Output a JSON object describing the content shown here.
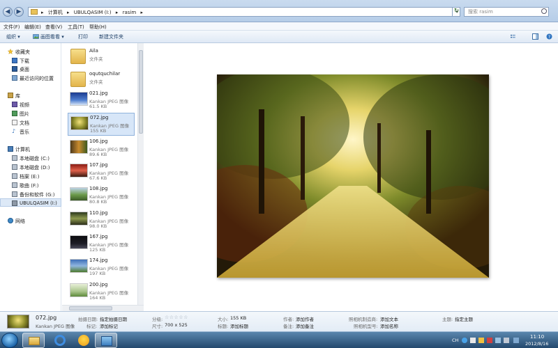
{
  "address": {
    "crumbs": [
      "计算机",
      "UBULQASIM (I:)",
      "rasim"
    ],
    "search_placeholder": "搜索 rasim"
  },
  "menu": {
    "items": [
      "文件(F)",
      "编辑(E)",
      "查看(V)",
      "工具(T)",
      "帮助(H)"
    ]
  },
  "toolbar": {
    "organize": "组织 ▾",
    "preview": "画图看看 ▾",
    "print": "打印",
    "new_folder": "新建文件夹"
  },
  "nav": {
    "favorites": "收藏夹",
    "download": "下载",
    "desktop": "桌面",
    "recent": "最近访问的位置",
    "libraries": "库",
    "videos": "视频",
    "pictures": "图片",
    "documents": "文档",
    "music": "音乐",
    "computer": "计算机",
    "drive_c": "本地磁盘 (C:)",
    "drive_d": "本地磁盘 (D:)",
    "drive_e": "档案 (E:)",
    "drive_f": "歌曲 (F:)",
    "drive_g": "备份和软件 (G:)",
    "drive_i": "UBULQASIM (I:)",
    "network": "网络"
  },
  "files": [
    {
      "name": "Aila",
      "type": "文件夹",
      "size": ""
    },
    {
      "name": "oqutquchilar",
      "type": "文件夹",
      "size": ""
    },
    {
      "name": "021.jpg",
      "type": "Kankan JPEG 图像",
      "size": "61.5 KB"
    },
    {
      "name": "072.jpg",
      "type": "Kankan JPEG 图像",
      "size": "155 KB"
    },
    {
      "name": "106.jpg",
      "type": "Kankan JPEG 图像",
      "size": "89.6 KB"
    },
    {
      "name": "107.jpg",
      "type": "Kankan JPEG 图像",
      "size": "67.6 KB"
    },
    {
      "name": "108.jpg",
      "type": "Kankan JPEG 图像",
      "size": "80.8 KB"
    },
    {
      "name": "110.jpg",
      "type": "Kankan JPEG 图像",
      "size": "98.0 KB"
    },
    {
      "name": "167.jpg",
      "type": "Kankan JPEG 图像",
      "size": "125 KB"
    },
    {
      "name": "174.jpg",
      "type": "Kankan JPEG 图像",
      "size": "197 KB"
    },
    {
      "name": "200.jpg",
      "type": "Kankan JPEG 图像",
      "size": "164 KB"
    }
  ],
  "details": {
    "name": "072.jpg",
    "type": "Kankan JPEG 图像",
    "date_taken_k": "拍摄日期:",
    "date_taken_v": "指定拍摄日期",
    "tags_k": "标记:",
    "tags_v": "添加标记",
    "rating_k": "分级:",
    "rating_stars": "☆☆☆☆☆",
    "dimensions_k": "尺寸:",
    "dimensions_v": "700 x 525",
    "size_k": "大小:",
    "size_v": "155 KB",
    "title_k": "标题:",
    "title_v": "添加标题",
    "author_k": "作者:",
    "author_v": "添加作者",
    "comments_k": "备注:",
    "comments_v": "添加备注",
    "maker_k": "照相机制造商:",
    "maker_v": "添加文本",
    "model_k": "照相机型号:",
    "model_v": "添加名称",
    "subject_k": "主题:",
    "subject_v": "指定主题"
  },
  "tray": {
    "lang": "CH",
    "time": "11:10",
    "date": "2012/8/16"
  }
}
